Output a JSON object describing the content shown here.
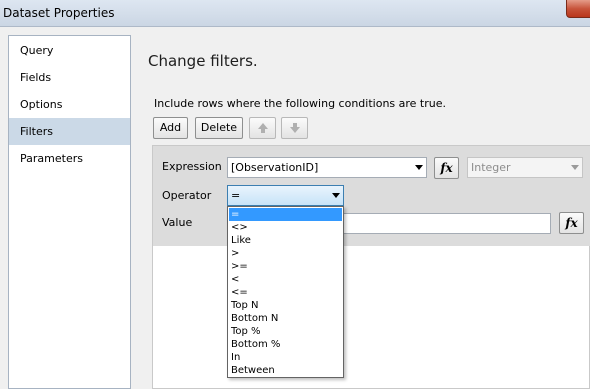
{
  "window": {
    "title": "Dataset Properties"
  },
  "sidebar": {
    "items": [
      {
        "label": "Query",
        "selected": false
      },
      {
        "label": "Fields",
        "selected": false
      },
      {
        "label": "Options",
        "selected": false
      },
      {
        "label": "Filters",
        "selected": true
      },
      {
        "label": "Parameters",
        "selected": false
      }
    ]
  },
  "main": {
    "heading": "Change filters.",
    "subheading": "Include rows where the following conditions are true.",
    "toolbar": {
      "add_label": "Add",
      "delete_label": "Delete"
    },
    "filter": {
      "expression_label": "Expression",
      "expression_value": "[ObservationID]",
      "type_value": "Integer",
      "operator_label": "Operator",
      "operator_value": "=",
      "value_label": "Value",
      "fx_label": "fx"
    },
    "operator_options": [
      "=",
      "<>",
      "Like",
      ">",
      ">=",
      "<",
      "<=",
      "Top N",
      "Bottom N",
      "Top %",
      "Bottom %",
      "In",
      "Between"
    ],
    "selected_operator_index": 0
  },
  "colors": {
    "selection": "#3399ff",
    "sidebar_selected": "#cbd9e7",
    "close_button": "#c7533a"
  }
}
